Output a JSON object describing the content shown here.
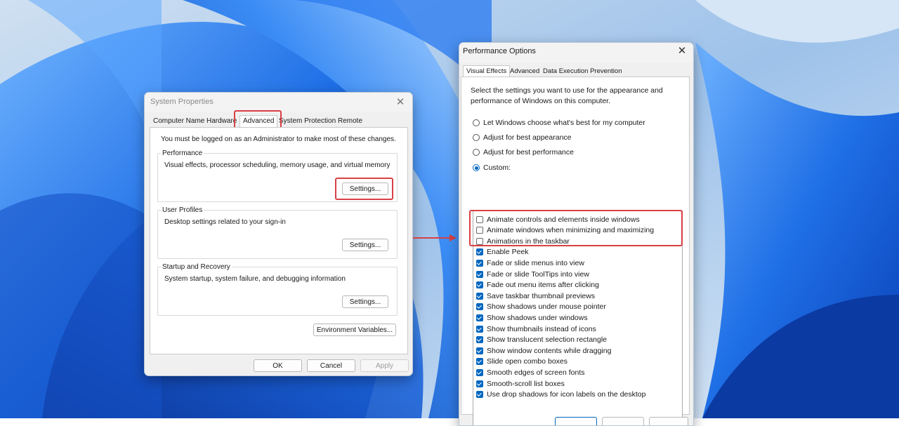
{
  "system_properties": {
    "title": "System Properties",
    "tabs": [
      "Computer Name",
      "Hardware",
      "Advanced",
      "System Protection",
      "Remote"
    ],
    "active_tab": "Advanced",
    "admin_note": "You must be logged on as an Administrator to make most of these changes.",
    "groups": [
      {
        "title": "Performance",
        "description": "Visual effects, processor scheduling, memory usage, and virtual memory",
        "button": "Settings..."
      },
      {
        "title": "User Profiles",
        "description": "Desktop settings related to your sign-in",
        "button": "Settings..."
      },
      {
        "title": "Startup and Recovery",
        "description": "System startup, system failure, and debugging information",
        "button": "Settings..."
      }
    ],
    "env_button": "Environment Variables...",
    "footer": {
      "ok": "OK",
      "cancel": "Cancel",
      "apply": "Apply"
    }
  },
  "performance_options": {
    "title": "Performance Options",
    "tabs": [
      "Visual Effects",
      "Advanced",
      "Data Execution Prevention"
    ],
    "active_tab": "Visual Effects",
    "intro": [
      "Select the settings you want to use for the appearance and",
      "performance of Windows on this computer."
    ],
    "radios": [
      {
        "label": "Let Windows choose what's best for my computer",
        "selected": false
      },
      {
        "label": "Adjust for best appearance",
        "selected": false
      },
      {
        "label": "Adjust for best performance",
        "selected": false
      },
      {
        "label": "Custom:",
        "selected": true
      }
    ],
    "effects": [
      {
        "label": "Animate controls and elements inside windows",
        "checked": false
      },
      {
        "label": "Animate windows when minimizing and maximizing",
        "checked": false
      },
      {
        "label": "Animations in the taskbar",
        "checked": false
      },
      {
        "label": "Enable Peek",
        "checked": true
      },
      {
        "label": "Fade or slide menus into view",
        "checked": true
      },
      {
        "label": "Fade or slide ToolTips into view",
        "checked": true
      },
      {
        "label": "Fade out menu items after clicking",
        "checked": true
      },
      {
        "label": "Save taskbar thumbnail previews",
        "checked": true
      },
      {
        "label": "Show shadows under mouse pointer",
        "checked": true
      },
      {
        "label": "Show shadows under windows",
        "checked": true
      },
      {
        "label": "Show thumbnails instead of icons",
        "checked": true
      },
      {
        "label": "Show translucent selection rectangle",
        "checked": true
      },
      {
        "label": "Show window contents while dragging",
        "checked": true
      },
      {
        "label": "Slide open combo boxes",
        "checked": true
      },
      {
        "label": "Smooth edges of screen fonts",
        "checked": true
      },
      {
        "label": "Smooth-scroll list boxes",
        "checked": true
      },
      {
        "label": "Use drop shadows for icon labels on the desktop",
        "checked": true
      }
    ]
  },
  "colors": {
    "highlight": "#d84045",
    "accent": "#0067c0"
  },
  "icons": [
    "close-icon",
    "arrow-icon"
  ]
}
